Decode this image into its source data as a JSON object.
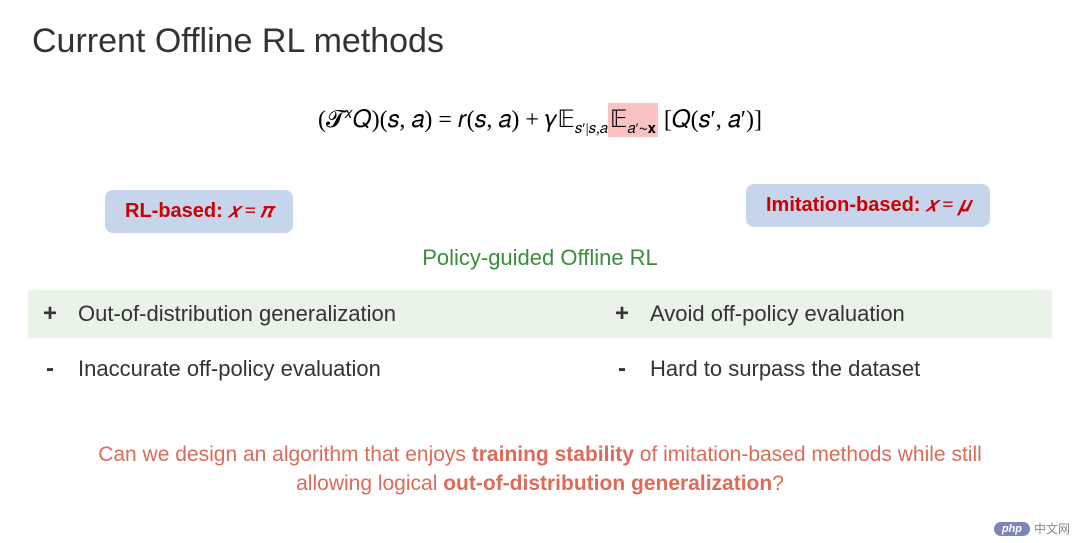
{
  "title": "Current Offline RL methods",
  "equation": {
    "lhs": "(𝓣",
    "sup_x": "𝑥",
    "lhs2": "𝑄)(𝑠, 𝑎) = 𝑟(𝑠, 𝑎) + 𝛾𝔼",
    "sub1": "𝑠′|𝑠,𝑎",
    "highlight_E": "𝔼",
    "highlight_sub": "𝑎′∼𝐱",
    "rhs": " [𝑄(𝑠′, 𝑎′)]"
  },
  "badges": {
    "left_label": "RL-based: ",
    "left_math": "𝑥 = 𝜋",
    "right_label": "Imitation-based: ",
    "right_math": "𝑥 = 𝜇"
  },
  "subtitle": "Policy-guided Offline RL",
  "rows": {
    "plus": {
      "sign": "+",
      "left": "Out-of-distribution generalization",
      "right": "Avoid off-policy evaluation"
    },
    "minus": {
      "sign": "-",
      "left": "Inaccurate off-policy evaluation",
      "right": "Hard to surpass the dataset"
    }
  },
  "question": {
    "p1": "Can we design an algorithm that enjoys ",
    "b1": "training stability",
    "p2": " of imitation-based methods while still allowing logical ",
    "b2": "out-of-distribution generalization",
    "p3": "?"
  },
  "watermark": {
    "pill": "php",
    "text": "中文网"
  }
}
